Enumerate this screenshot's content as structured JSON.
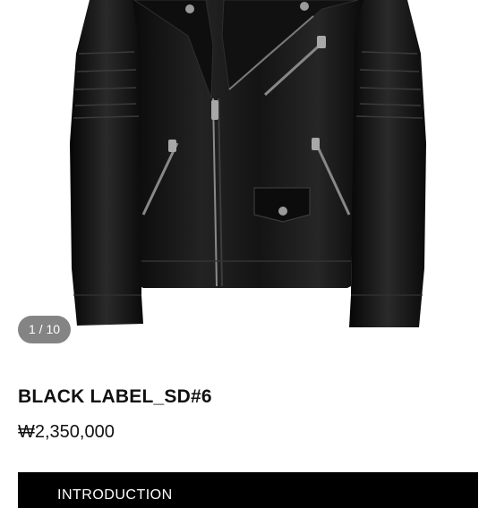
{
  "gallery": {
    "counter": "1 / 10"
  },
  "product": {
    "title": "BLACK LABEL_SD#6",
    "price": "₩2,350,000"
  },
  "actions": {
    "introduction_label": "INTRODUCTION"
  },
  "colors": {
    "leather": "#151515",
    "button_bg": "#000000",
    "counter_bg": "#6e6e6e"
  }
}
